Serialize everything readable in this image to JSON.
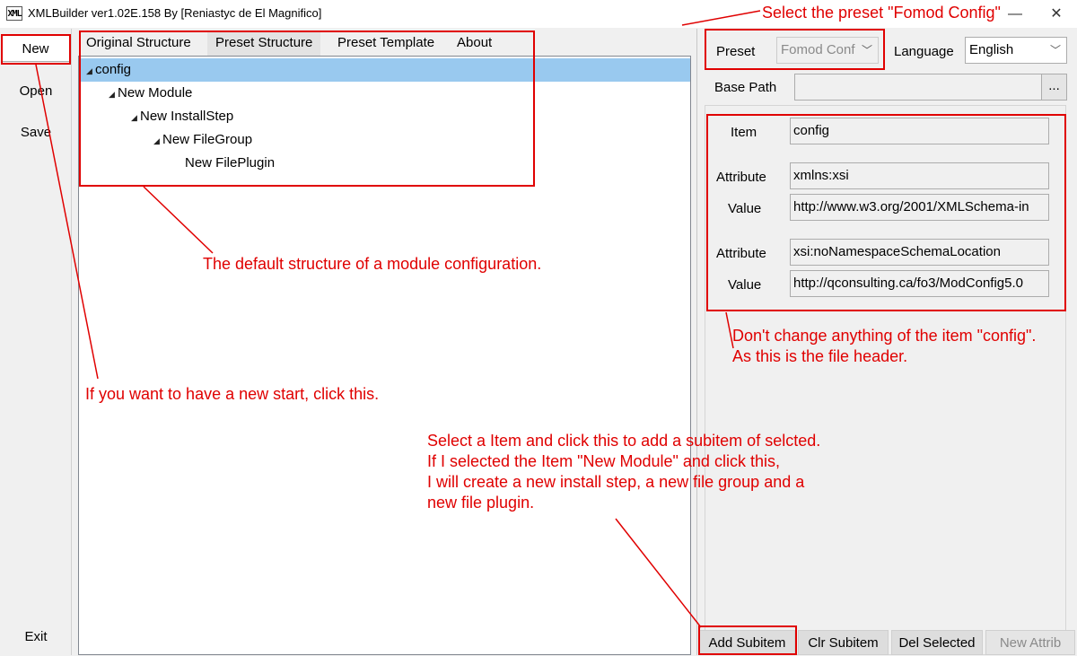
{
  "window": {
    "title": "XMLBuilder ver1.02E.158 By [Reniastyc de El Magnifico]",
    "icon_text": "XML",
    "minimize_glyph": "—",
    "close_glyph": "✕"
  },
  "sidebar": {
    "new_label": "New",
    "open_label": "Open",
    "save_label": "Save",
    "exit_label": "Exit"
  },
  "tabs": [
    {
      "label": "Original Structure"
    },
    {
      "label": "Preset Structure"
    },
    {
      "label": "Preset Template"
    },
    {
      "label": "About"
    }
  ],
  "tree": {
    "items": [
      {
        "label": "config",
        "expanded": true,
        "selected": true
      },
      {
        "label": "New Module",
        "expanded": true
      },
      {
        "label": "New InstallStep",
        "expanded": true
      },
      {
        "label": "New FileGroup",
        "expanded": true
      },
      {
        "label": "New FilePlugin",
        "expanded": false
      }
    ],
    "expand_glyph": "◢"
  },
  "settings": {
    "preset_label": "Preset",
    "preset_value": "Fomod Conf",
    "language_label": "Language",
    "language_value": "English",
    "base_path_label": "Base Path",
    "base_path_value": "",
    "browse_label": "..."
  },
  "properties": {
    "item_label": "Item",
    "item_value": "config",
    "attributes": [
      {
        "attribute_label": "Attribute",
        "attribute_value": "xmlns:xsi",
        "value_label": "Value",
        "value_value": "http://www.w3.org/2001/XMLSchema-in"
      },
      {
        "attribute_label": "Attribute",
        "attribute_value": "xsi:noNamespaceSchemaLocation",
        "value_label": "Value",
        "value_value": "http://qconsulting.ca/fo3/ModConfig5.0"
      }
    ]
  },
  "buttons": {
    "add_subitem": "Add Subitem",
    "clr_subitem": "Clr Subitem",
    "del_selected": "Del Selected",
    "new_attrib": "New Attrib"
  },
  "annotations": {
    "select_preset": "Select the preset \"Fomod Config\"",
    "default_structure": "The default structure of a module configuration.",
    "dont_change_line1": "Don't change anything of the item \"config\".",
    "dont_change_line2": "As this is the file header.",
    "new_start": "If you want to have a new start, click this.",
    "add_sub_line1": "Select a Item and click this to add a subitem of selcted.",
    "add_sub_line2": "If I selected the Item \"New Module\" and click this,",
    "add_sub_line3": "I will create a new install step, a new file group and a",
    "add_sub_line4": "new file plugin."
  },
  "colors": {
    "annotation": "#e00000",
    "selection": "#99c9ef"
  }
}
